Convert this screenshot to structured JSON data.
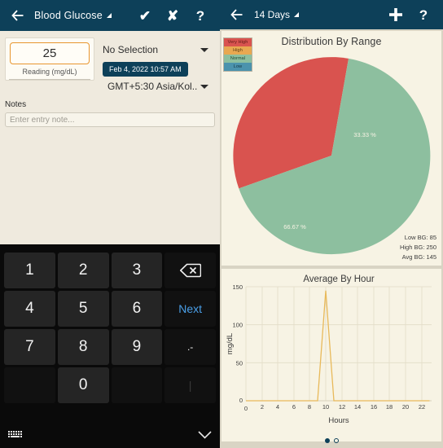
{
  "left": {
    "appbar": {
      "back_icon": "back-arrow-icon",
      "title": "Blood Glucose",
      "actions": [
        {
          "name": "confirm-check",
          "glyph": "✔"
        },
        {
          "name": "cancel-x",
          "glyph": "✘"
        },
        {
          "name": "help-question",
          "glyph": "?"
        }
      ]
    },
    "reading": {
      "value": "25",
      "label": "Reading (mg/dL)"
    },
    "category": {
      "value": "No Selection"
    },
    "date_chip": {
      "value": "Feb 4, 2022 10:57 AM"
    },
    "timezone": {
      "value": "GMT+5:30 Asia/Kol.."
    },
    "notes": {
      "label": "Notes",
      "placeholder": "Enter entry note...",
      "value": ""
    },
    "keyboard": {
      "keys": [
        {
          "label": "1",
          "style": "key"
        },
        {
          "label": "2",
          "style": "key"
        },
        {
          "label": "3",
          "style": "key"
        },
        {
          "label": "⌫",
          "style": "key dark",
          "name": "backspace-key"
        },
        {
          "label": "4",
          "style": "key"
        },
        {
          "label": "5",
          "style": "key"
        },
        {
          "label": "6",
          "style": "key"
        },
        {
          "label": "Next",
          "style": "key next",
          "name": "next-key"
        },
        {
          "label": "7",
          "style": "key"
        },
        {
          "label": "8",
          "style": "key"
        },
        {
          "label": "9",
          "style": "key"
        },
        {
          "label": ".-",
          "style": "key punct",
          "name": "punctuation-key"
        },
        {
          "label": "",
          "style": "key blank",
          "name": "blank-key-left"
        },
        {
          "label": "0",
          "style": "key"
        },
        {
          "label": "",
          "style": "key blank",
          "name": "blank-key-right"
        },
        {
          "label": "|",
          "style": "key bar",
          "name": "bar-key"
        }
      ],
      "switch_icon": "keyboard-switch-icon",
      "hide_icon": "chevron-down-icon"
    }
  },
  "right": {
    "appbar": {
      "back_icon": "back-arrow-icon",
      "title": "14 Days",
      "actions": [
        {
          "name": "add-entry",
          "glyph": "＋"
        },
        {
          "name": "help-question",
          "glyph": "?"
        }
      ]
    },
    "legend": [
      {
        "label": "Very High",
        "color": "#d9534f"
      },
      {
        "label": "High",
        "color": "#e8a851"
      },
      {
        "label": "Normal",
        "color": "#8dbf9f"
      },
      {
        "label": "Low",
        "color": "#4b93ad"
      }
    ],
    "stats": {
      "low": "Low BG: 85",
      "high": "High BG: 250",
      "avg": "Avg BG: 145"
    },
    "page_dots": {
      "active": 0,
      "total": 2
    }
  },
  "chart_data": [
    {
      "type": "pie",
      "title": "Distribution By Range",
      "legend_position": "top-left",
      "slices": [
        {
          "label": "Very High",
          "value": 33.33,
          "display": "33.33 %",
          "color": "#d9534f"
        },
        {
          "label": "Normal",
          "value": 66.67,
          "display": "66.67 %",
          "color": "#8dbf9f"
        }
      ],
      "annotations": [
        "Low BG: 85",
        "High BG: 250",
        "Avg BG: 145"
      ]
    },
    {
      "type": "line",
      "title": "Average By Hour",
      "xlabel": "Hours",
      "ylabel": "mg/dL",
      "xticks": [
        0,
        2,
        4,
        6,
        8,
        10,
        12,
        14,
        16,
        18,
        20,
        22
      ],
      "yticks": [
        0,
        50,
        100,
        150
      ],
      "xlim": [
        0,
        23
      ],
      "ylim": [
        0,
        155
      ],
      "grid": true,
      "line_color": "#e8b95a",
      "x": [
        0,
        1,
        2,
        3,
        4,
        5,
        6,
        7,
        8,
        9,
        10,
        11,
        12,
        13,
        14,
        15,
        16,
        17,
        18,
        19,
        20,
        21,
        22,
        23
      ],
      "values": [
        0,
        0,
        0,
        0,
        0,
        0,
        0,
        0,
        0,
        0,
        145,
        0,
        0,
        0,
        0,
        0,
        0,
        0,
        0,
        0,
        0,
        0,
        0,
        0
      ]
    }
  ]
}
